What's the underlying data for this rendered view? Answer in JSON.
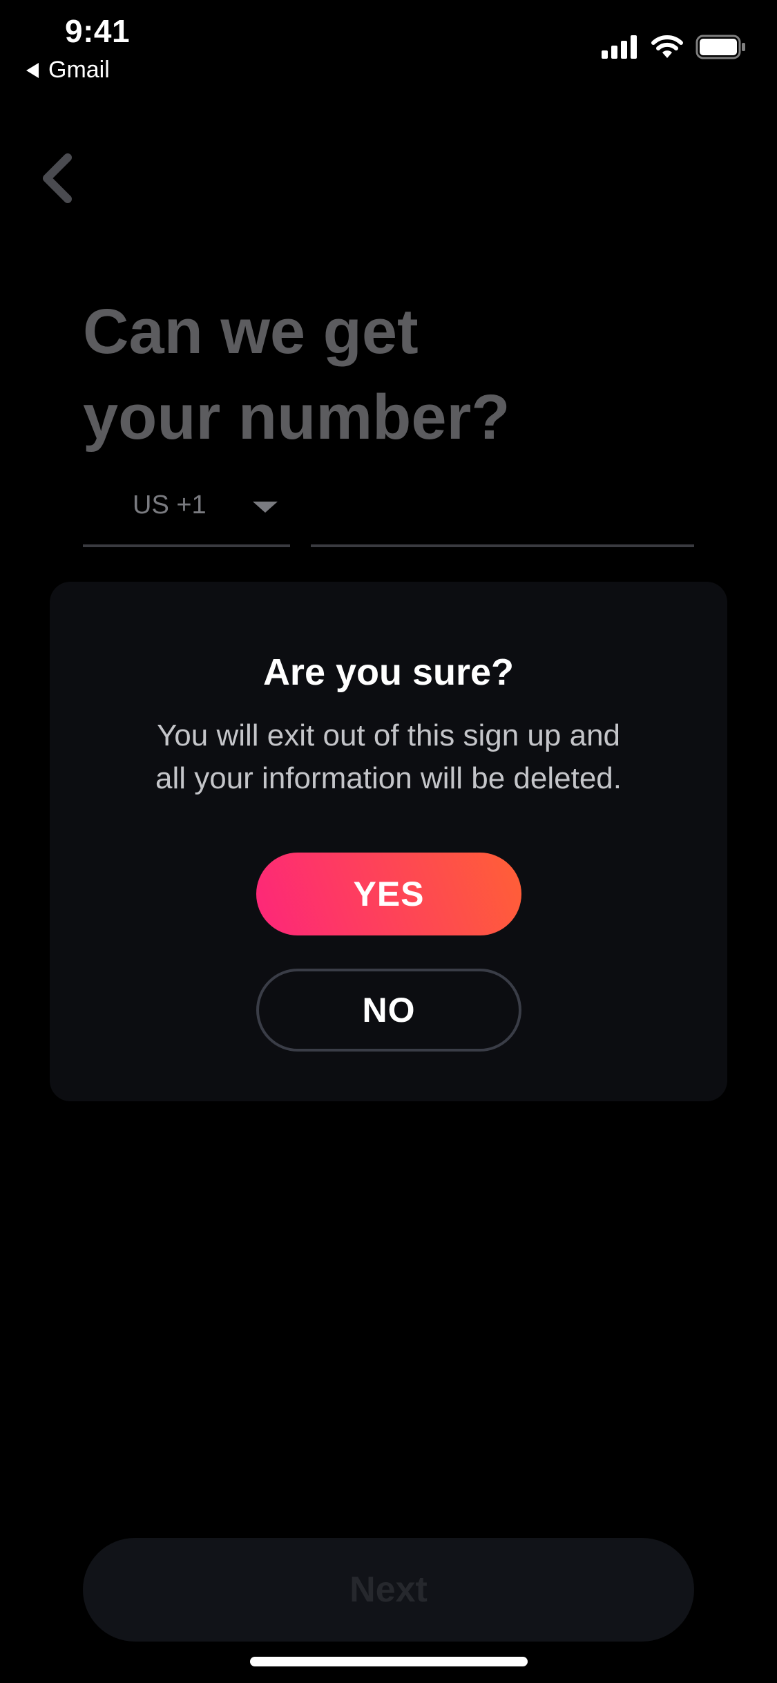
{
  "status_bar": {
    "time": "9:41",
    "back_app": "Gmail",
    "icons": [
      "signal-icon",
      "wifi-icon",
      "battery-icon"
    ]
  },
  "nav": {
    "back_icon": "chevron-left-icon"
  },
  "heading": {
    "line1": "Can we get",
    "line2": "your number?"
  },
  "phone": {
    "country_code": "US +1",
    "number_value": ""
  },
  "dialog": {
    "title": "Are you sure?",
    "message_line1": "You will exit out of this sign up and",
    "message_line2": "all your information will be deleted.",
    "yes_label": "YES",
    "no_label": "NO"
  },
  "footer": {
    "next_label": "Next"
  },
  "colors": {
    "background": "#000000",
    "dialog_bg": "#0c0d11",
    "accent_start": "#fd267a",
    "accent_end": "#ff6036",
    "heading_dimmed": "#5c5c5f",
    "next_disabled_bg": "#111318"
  }
}
